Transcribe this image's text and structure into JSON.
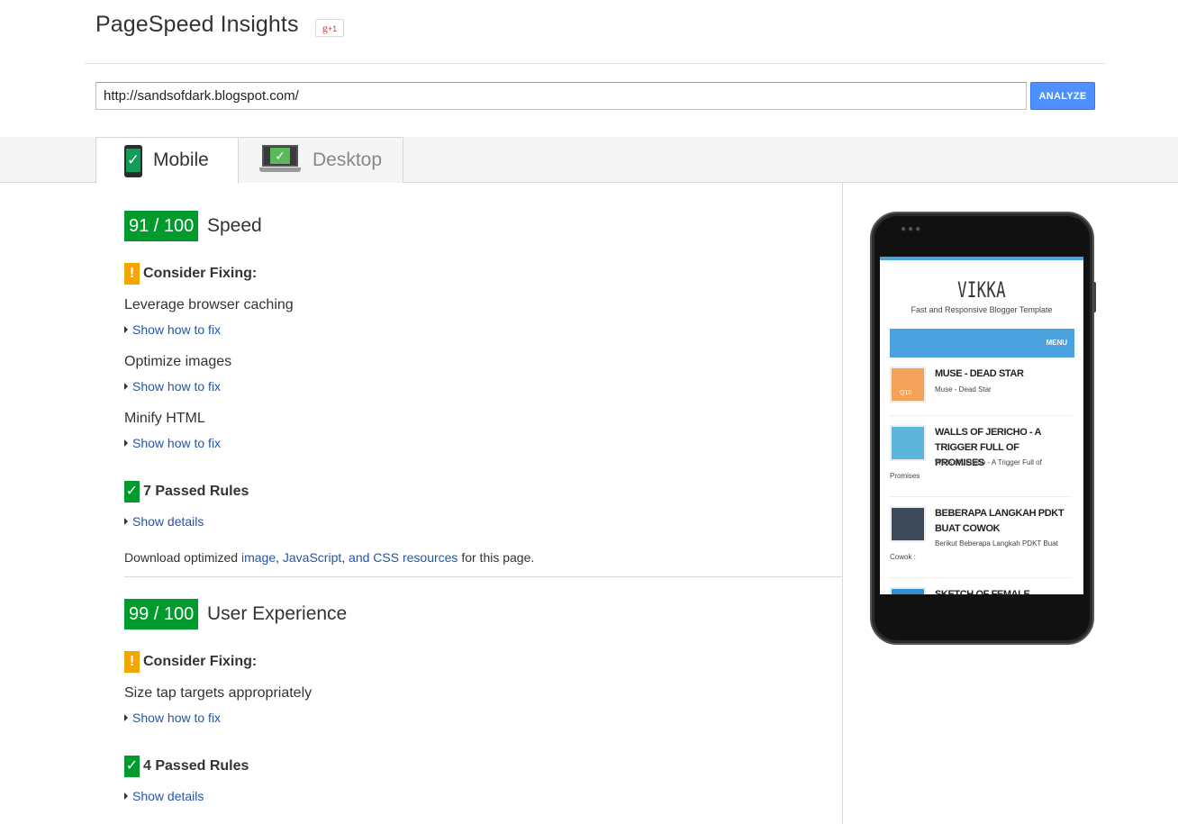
{
  "header": {
    "app_title": "PageSpeed Insights",
    "gplus_g": "g",
    "gplus_plus": "+1"
  },
  "search": {
    "url_value": "http://sandsofdark.blogspot.com/",
    "analyze_label": "ANALYZE"
  },
  "tabs": [
    {
      "label": "Mobile",
      "active": true
    },
    {
      "label": "Desktop",
      "active": false
    }
  ],
  "icons": {
    "check_glyph": "✓",
    "warn_glyph": "!"
  },
  "speed": {
    "score": "91 / 100",
    "title": "Speed",
    "consider_fixing": "Consider Fixing:",
    "rules": [
      {
        "name": "Leverage browser caching",
        "link": "Show how to fix"
      },
      {
        "name": "Optimize images",
        "link": "Show how to fix"
      },
      {
        "name": "Minify HTML",
        "link": "Show how to fix"
      }
    ],
    "passed": "7 Passed Rules",
    "details_link": "Show details",
    "download": {
      "prefix": "Download optimized ",
      "link_image": "image",
      "link_js": "JavaScript",
      "link_css": "and CSS resources",
      "suffix": " for this page."
    }
  },
  "ux": {
    "score": "99 / 100",
    "title": "User Experience",
    "consider_fixing": "Consider Fixing:",
    "rules": [
      {
        "name": "Size tap targets appropriately",
        "link": "Show how to fix"
      }
    ],
    "passed": "4 Passed Rules",
    "details_link": "Show details"
  },
  "preview": {
    "blog_title": "VIKKA",
    "tagline": "Fast and Responsive Blogger Template",
    "menu": "MENU",
    "posts": [
      {
        "title": "MUSE - DEAD STAR",
        "excerpt": "Muse - Dead Star",
        "thumb_color": "#f4a25a",
        "thumb_text": "Q10"
      },
      {
        "title": "WALLS OF JERICHO - A TRIGGER FULL OF PROMISES",
        "excerpt": "Walls of Jericho - A Trigger Full of Promises",
        "thumb_color": "#5bb5da",
        "thumb_text": ""
      },
      {
        "title": "BEBERAPA LANGKAH PDKT BUAT COWOK",
        "excerpt": "Berikut  Beberapa Langkah PDKT Buat Cowok :",
        "thumb_color": "#3d4a5a",
        "thumb_text": ""
      },
      {
        "title": "SKETCH OF FEMALE INDONESIAN",
        "excerpt": "",
        "thumb_color": "#2d8fd4",
        "thumb_text": ""
      }
    ]
  },
  "colors": {
    "score_green": "#009a2d",
    "warn_orange": "#f5a500",
    "link_blue": "#2255aa",
    "button_blue": "#4d90fe",
    "preview_accent": "#4aa3df"
  }
}
